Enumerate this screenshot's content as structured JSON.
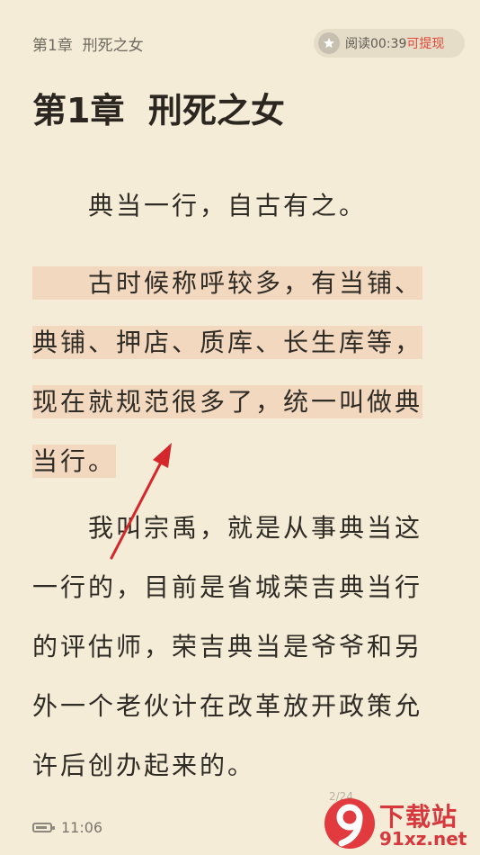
{
  "header": {
    "chapter": "第1章  刑死之女",
    "reward": {
      "icon": "star-icon",
      "label": "阅读00:39",
      "action": "可提现"
    }
  },
  "chapter_title": "第1章  刑死之女",
  "paragraphs": [
    {
      "lines": [
        "　　典当一行，自古有之。"
      ]
    },
    {
      "lines": [
        "　　古时候称呼较多，有当铺、",
        "典铺、押店、质库、长生库等，",
        "现在就规范很多了，统一叫做典",
        "当行。"
      ]
    },
    {
      "lines": [
        "　　我叫宗禹，就是从事典当这",
        "一行的，目前是省城荣吉典当行",
        "的评估师，荣吉典当是爷爷和另",
        "外一个老伙计在改革放开政策允",
        "许后创办起来的。"
      ]
    }
  ],
  "status": {
    "battery_icon": "battery-icon",
    "time": "11:06"
  },
  "watermark": {
    "logo": "9-logo",
    "name": "下载站",
    "domain": "91xz.net",
    "page": "2/24"
  },
  "colors": {
    "background": "#f5ecd8",
    "highlight": "#f3d8c0",
    "arrow": "#d4272b",
    "accent": "#e0473a"
  }
}
